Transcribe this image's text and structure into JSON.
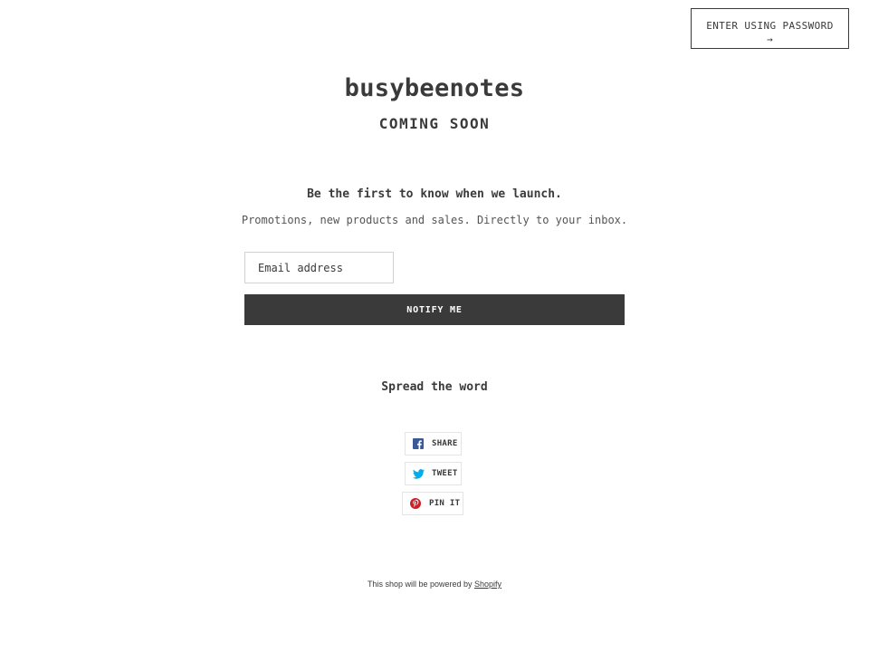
{
  "header": {
    "enter_password_label": "ENTER USING PASSWORD",
    "enter_password_arrow": "→"
  },
  "hero": {
    "shop_name": "busybeenotes",
    "tagline": "COMING SOON"
  },
  "signup": {
    "headline": "Be the first to know when we launch.",
    "subline": "Promotions, new products and sales. Directly to your inbox.",
    "email_placeholder": "Email address",
    "notify_label": "NOTIFY ME"
  },
  "share": {
    "heading": "Spread the word",
    "buttons": [
      {
        "label": "SHARE",
        "icon": "facebook-icon",
        "color": "#3b5998"
      },
      {
        "label": "TWEET",
        "icon": "twitter-icon",
        "color": "#00aced"
      },
      {
        "label": "PIN IT",
        "icon": "pinterest-icon",
        "color": "#cb2027"
      }
    ]
  },
  "footer": {
    "powered_text": "This shop will be powered by",
    "shopify_link": "Shopify"
  }
}
